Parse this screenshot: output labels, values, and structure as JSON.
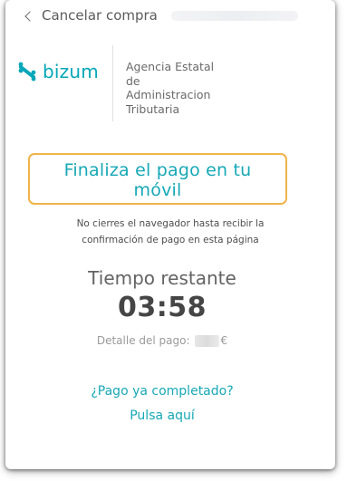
{
  "topbar": {
    "back_label": "Cancelar compra"
  },
  "brand": {
    "name": "bizum",
    "color": "#05a7b8"
  },
  "merchant": {
    "lines": [
      "Agencia Estatal",
      "de",
      "Administracion",
      "Tributaria"
    ]
  },
  "main": {
    "headline_line1": "Finaliza el pago en tu",
    "headline_line2": "móvil",
    "notice_line1": "No cierres el navegador hasta recibir la",
    "notice_line2": "confirmación de pago en esta página",
    "timer_label": "Tiempo restante",
    "timer_value": "03:58",
    "detail_label": "Detalle del pago:",
    "currency": "€",
    "completed_question": "¿Pago ya completado?",
    "click_here": "Pulsa aquí"
  },
  "colors": {
    "accent": "#17a8b7",
    "highlight_border": "#f0b44a"
  }
}
